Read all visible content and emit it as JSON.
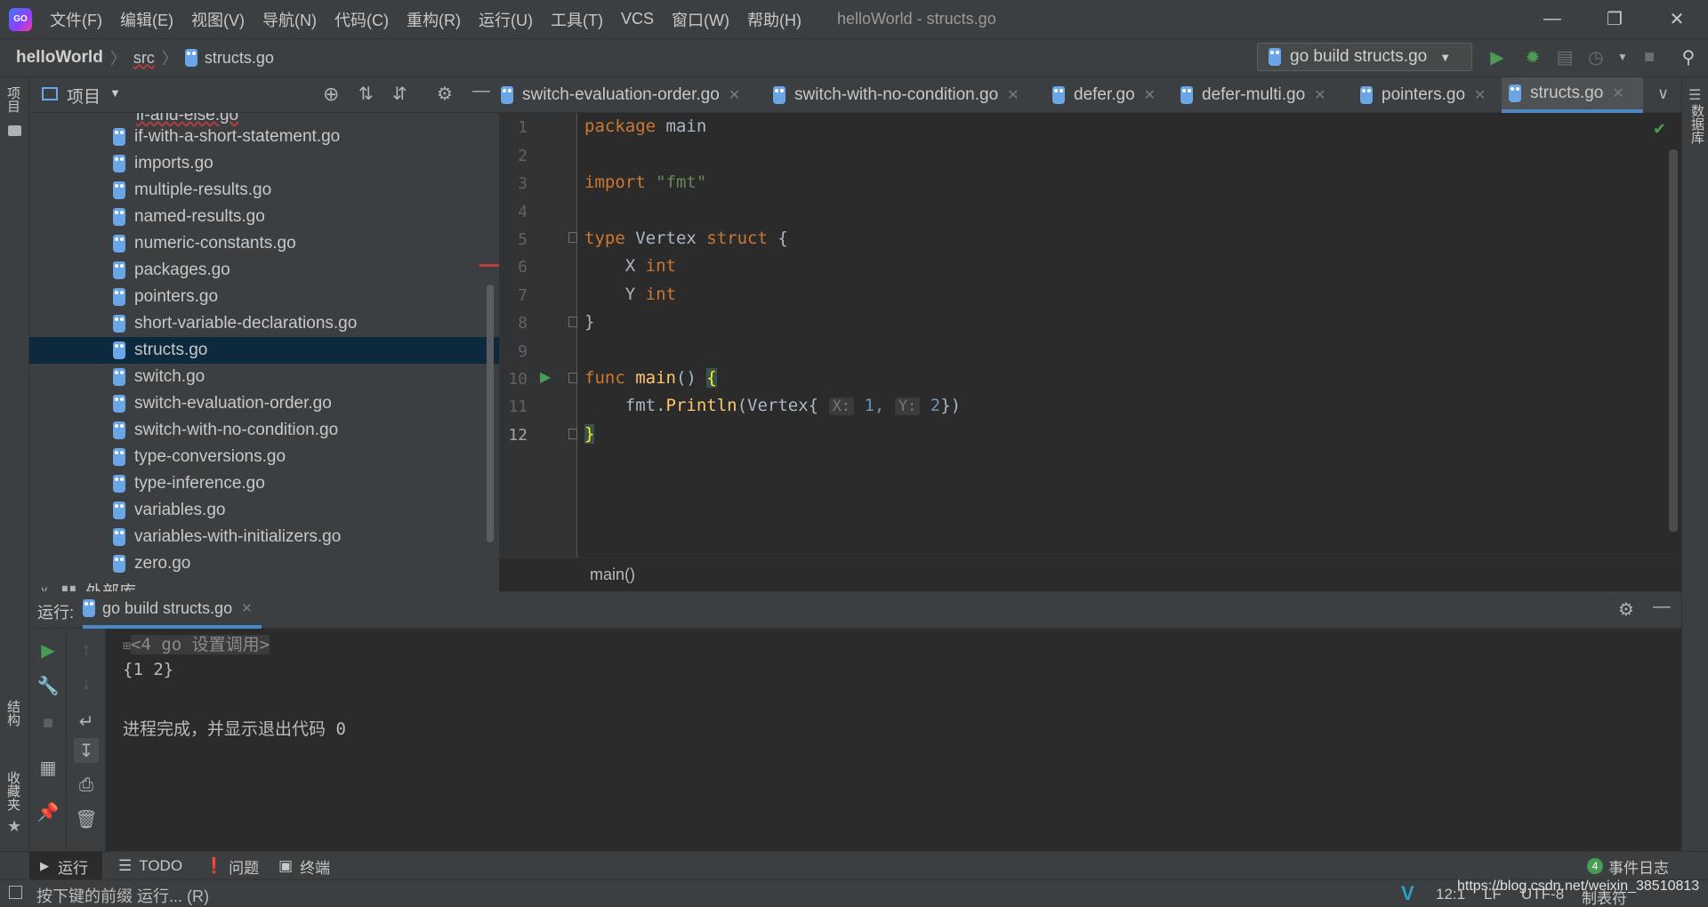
{
  "app": {
    "logo_text": "GO",
    "menu": [
      "文件(F)",
      "编辑(E)",
      "视图(V)",
      "导航(N)",
      "代码(C)",
      "重构(R)",
      "运行(U)",
      "工具(T)",
      "VCS",
      "窗口(W)",
      "帮助(H)"
    ],
    "window_title": "helloWorld - structs.go"
  },
  "nav": {
    "project": "helloWorld",
    "folder": "src",
    "file": "structs.go",
    "run_config": "go build structs.go"
  },
  "left_stripe": {
    "project": "项目",
    "structure": "结构",
    "favorites": "收藏夹"
  },
  "right_stripe": {
    "database": "数据库"
  },
  "project_panel": {
    "title": "项目",
    "partial_top": "if-and-else.go",
    "files": [
      "if-with-a-short-statement.go",
      "imports.go",
      "multiple-results.go",
      "named-results.go",
      "numeric-constants.go",
      "packages.go",
      "pointers.go",
      "short-variable-declarations.go",
      "structs.go",
      "switch.go",
      "switch-evaluation-order.go",
      "switch-with-no-condition.go",
      "type-conversions.go",
      "type-inference.go",
      "variables.go",
      "variables-with-initializers.go",
      "zero.go"
    ],
    "selected": "structs.go",
    "external_libs": "外部库"
  },
  "tabs": [
    "switch-evaluation-order.go",
    "switch-with-no-condition.go",
    "defer.go",
    "defer-multi.go",
    "pointers.go",
    "structs.go"
  ],
  "active_tab": "structs.go",
  "editor": {
    "line_numbers": [
      "1",
      "2",
      "3",
      "4",
      "5",
      "6",
      "7",
      "8",
      "9",
      "10",
      "11",
      "12"
    ],
    "code": {
      "l1_kw": "package",
      "l1_rest": " main",
      "l3_kw": "import",
      "l3_str": "\"fmt\"",
      "l5_kw": "type",
      "l5_name": " Vertex ",
      "l5_kw2": "struct",
      "l5_brace": " {",
      "l6_field": "    X ",
      "l6_type": "int",
      "l7_field": "    Y ",
      "l7_type": "int",
      "l8": "}",
      "l10_kw": "func",
      "l10_fn": " main",
      "l10_rest": "() ",
      "l10_brace": "{",
      "l11_a": "    fmt.",
      "l11_fn": "Println",
      "l11_b": "(Vertex{",
      "l11_hint_x": "X:",
      "l11_v1": " 1,",
      "l11_hint_y": "Y:",
      "l11_v2": " 2",
      "l11_c": "})",
      "l12": "}"
    },
    "breadcrumb": "main()"
  },
  "run": {
    "label": "运行:",
    "tab": "go build structs.go",
    "console": {
      "folded": "<4 go 设置调用>",
      "output": "{1 2}",
      "exit": "进程完成，并显示退出代码 0"
    }
  },
  "bottom_tabs": {
    "run": "运行",
    "todo": "TODO",
    "problems": "问题",
    "terminal": "终端",
    "event_log": "事件日志",
    "event_count": "4"
  },
  "status": {
    "hint": "按下键的前缀 运行... (R)",
    "position": "12:1",
    "line_sep": "LF",
    "encoding": "UTF-8",
    "indent": "制表符",
    "watermark": "https://blog.csdn.net/weixin_38510813"
  },
  "colors": {
    "accent": "#4a88c7",
    "run_green": "#499c54",
    "selection": "#0d293e"
  }
}
